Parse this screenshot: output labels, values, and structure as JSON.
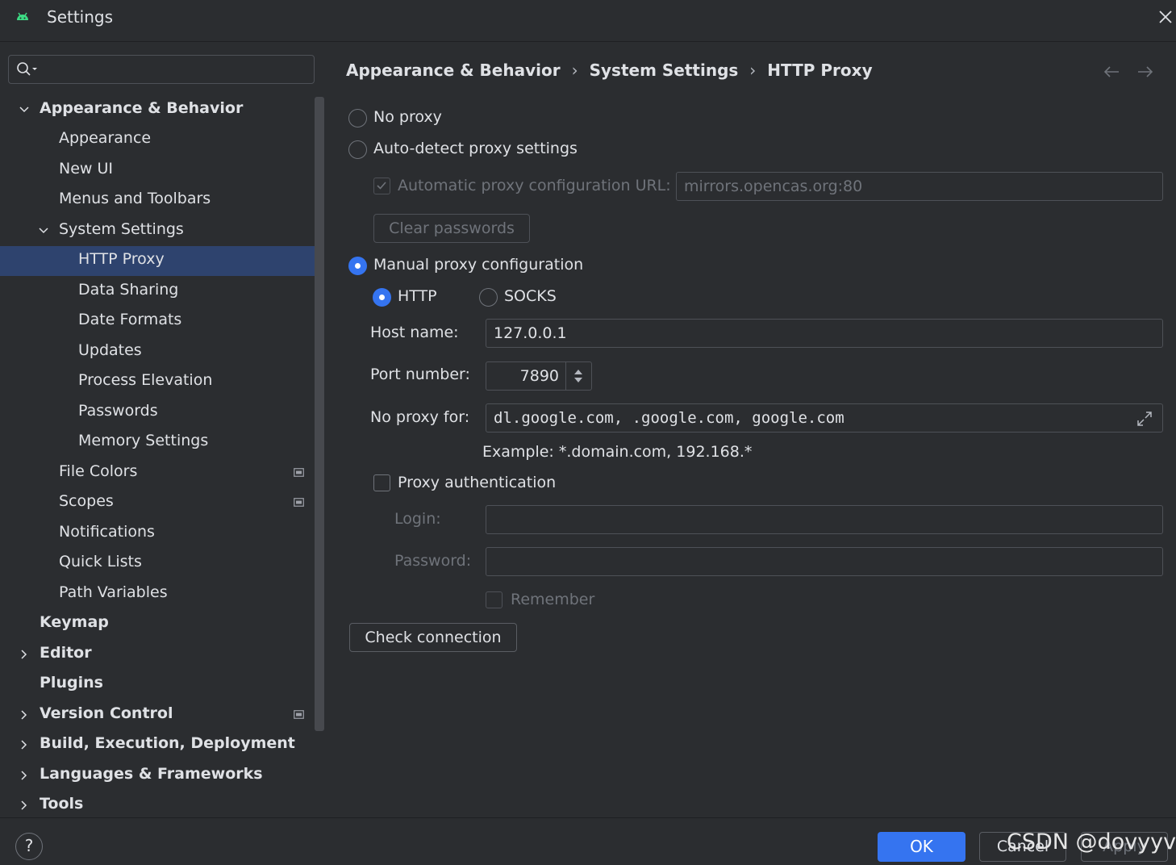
{
  "window": {
    "title": "Settings"
  },
  "search": {
    "value": "",
    "placeholder": ""
  },
  "tree": {
    "items": [
      {
        "label": "Appearance & Behavior"
      },
      {
        "label": "Appearance"
      },
      {
        "label": "New UI"
      },
      {
        "label": "Menus and Toolbars"
      },
      {
        "label": "System Settings"
      },
      {
        "label": "HTTP Proxy"
      },
      {
        "label": "Data Sharing"
      },
      {
        "label": "Date Formats"
      },
      {
        "label": "Updates"
      },
      {
        "label": "Process Elevation"
      },
      {
        "label": "Passwords"
      },
      {
        "label": "Memory Settings"
      },
      {
        "label": "File Colors"
      },
      {
        "label": "Scopes"
      },
      {
        "label": "Notifications"
      },
      {
        "label": "Quick Lists"
      },
      {
        "label": "Path Variables"
      },
      {
        "label": "Keymap"
      },
      {
        "label": "Editor"
      },
      {
        "label": "Plugins"
      },
      {
        "label": "Version Control"
      },
      {
        "label": "Build, Execution, Deployment"
      },
      {
        "label": "Languages & Frameworks"
      },
      {
        "label": "Tools"
      }
    ],
    "selected": "HTTP Proxy"
  },
  "breadcrumb": [
    "Appearance & Behavior",
    "System Settings",
    "HTTP Proxy"
  ],
  "proxy": {
    "no_proxy_label": "No proxy",
    "auto_detect_label": "Auto-detect proxy settings",
    "auto_config_url_label": "Automatic proxy configuration URL:",
    "auto_config_url_value": "mirrors.opencas.org:80",
    "clear_passwords_label": "Clear passwords",
    "manual_label": "Manual proxy configuration",
    "selected_mode": "Manual proxy configuration",
    "http_label": "HTTP",
    "socks_label": "SOCKS",
    "selected_type": "HTTP",
    "host_label": "Host name:",
    "host_value": "127.0.0.1",
    "port_label": "Port number:",
    "port_value": "7890",
    "no_proxy_for_label": "No proxy for:",
    "no_proxy_for_value": "dl.google.com, .google.com, google.com",
    "example_text": "Example: *.domain.com, 192.168.*",
    "auth_label": "Proxy authentication",
    "auth_checked": false,
    "login_label": "Login:",
    "login_value": "",
    "password_label": "Password:",
    "password_value": "",
    "remember_label": "Remember",
    "check_connection_label": "Check connection"
  },
  "footer": {
    "help_label": "?",
    "ok_label": "OK",
    "cancel_label": "Cancel",
    "apply_label": "Apply"
  },
  "watermark": "CSDN @dovyyve",
  "colors": {
    "background": "#2b2d30",
    "selection": "#2e436e",
    "accent": "#3574f0",
    "android_icon": "#3ddc84"
  }
}
